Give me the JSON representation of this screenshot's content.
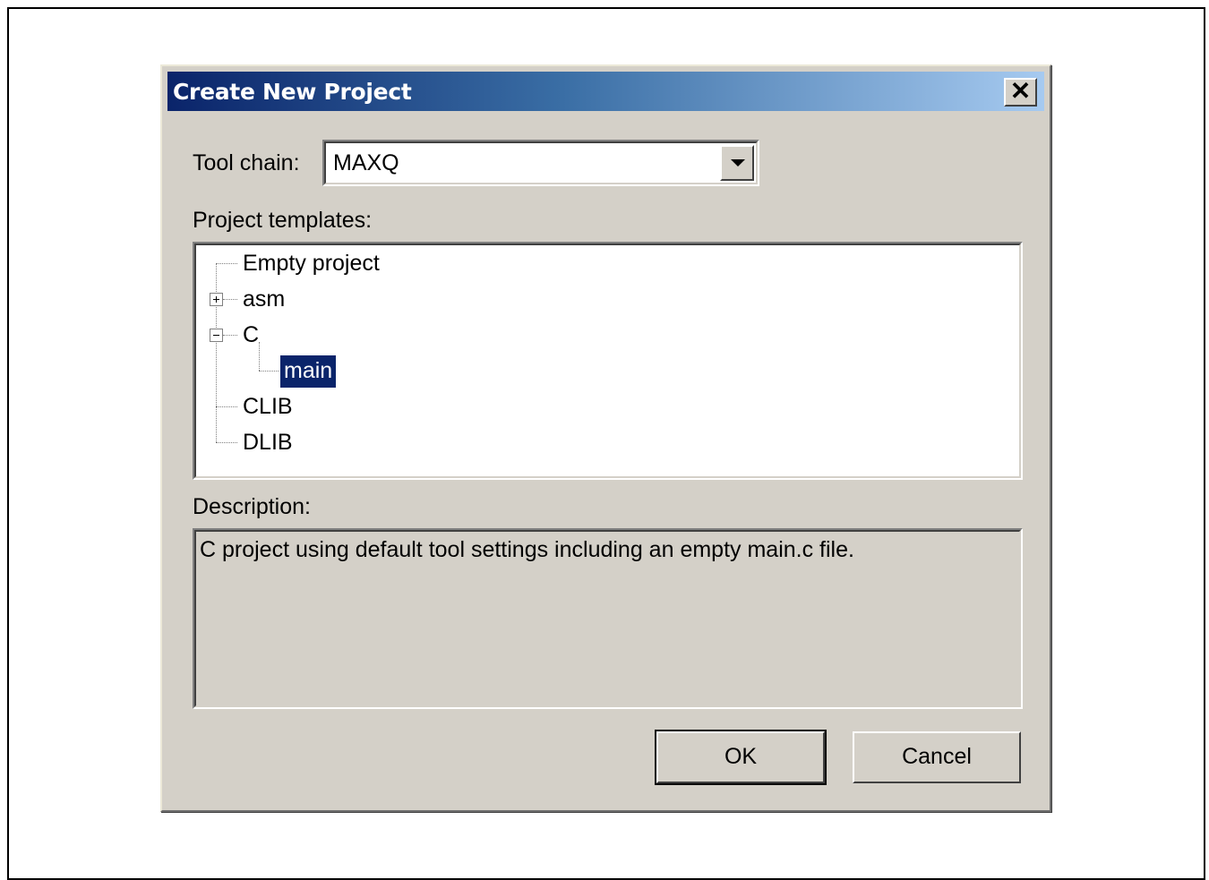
{
  "dialog": {
    "title": "Create New Project",
    "close_glyph": "✕",
    "toolchain_label": "Tool chain:",
    "toolchain_value": "MAXQ",
    "templates_label": "Project templates:",
    "tree": {
      "empty_project": "Empty project",
      "asm": "asm",
      "c": "C",
      "main": "main",
      "clib": "CLIB",
      "dlib": "DLIB",
      "selected": "main"
    },
    "description_label": "Description:",
    "description_text": "C project using default tool settings including an empty main.c file.",
    "ok_label": "OK",
    "cancel_label": "Cancel"
  },
  "icons": {
    "close": "close-icon",
    "dropdown": "chevron-down-icon",
    "expand": "plus-box-icon",
    "collapse": "minus-box-icon"
  },
  "colors": {
    "titlebar_start": "#0a246a",
    "titlebar_end": "#a6caf0",
    "selection": "#0a246a",
    "face": "#d4d0c8"
  }
}
